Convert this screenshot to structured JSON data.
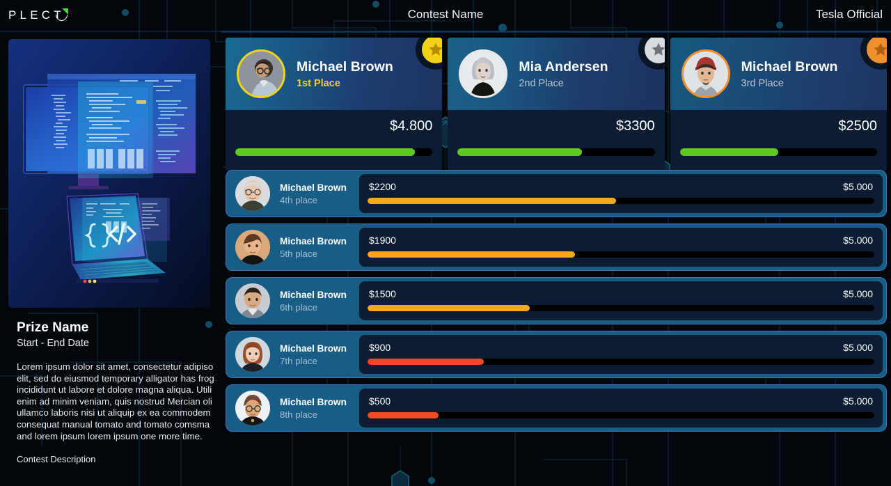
{
  "header": {
    "logo_text": "PLECT",
    "logo_icon": "plecto-circle-logo",
    "contest_title": "Contest Name",
    "account_name": "Tesla Official"
  },
  "left_panel": {
    "image_alt": "desktop-monitor-and-laptop-code-illustration",
    "prize_name": "Prize Name",
    "date_range": "Start - End Date",
    "description": "Lorem ipsum dolor sit amet, consectetur adipiso elit, sed do eiusmod temporary alligator has frog incididunt ut labore et dolore magna aliqua. Utili enim ad minim veniam, quis nostrud Mercian oli ullamco laboris nisi ut aliquip ex ea commodem consequat manual tomato and tomato comsma and lorem ipsum lorem ipsum one more time.",
    "description_label": "Contest Description"
  },
  "colors": {
    "bar_green": "#5cc91c",
    "bar_orange": "#f5a623",
    "bar_red": "#f04a23",
    "bar_track": "#000000",
    "gold": "#f4d21a",
    "silver": "#d8dce0",
    "bronze": "#ef8f2d",
    "row_bg": "#175d86",
    "row_border": "#4673b4",
    "panel_dark": "#0b1c33",
    "page_bg": "#03070b"
  },
  "podium": [
    {
      "rank": 1,
      "name": "Michael Brown",
      "place_label": "1st Place",
      "amount": "$4.800",
      "progress_pct": 91,
      "medal_icon": "gold-star-icon",
      "bar_color": "#5cc91c"
    },
    {
      "rank": 2,
      "name": "Mia Andersen",
      "place_label": "2nd Place",
      "amount": "$3300",
      "progress_pct": 63,
      "medal_icon": "silver-star-icon",
      "bar_color": "#5cc91c"
    },
    {
      "rank": 3,
      "name": "Michael Brown",
      "place_label": "3rd Place",
      "amount": "$2500",
      "progress_pct": 50,
      "medal_icon": "bronze-star-icon",
      "bar_color": "#5cc91c"
    }
  ],
  "rows": [
    {
      "name": "Michael Brown",
      "place_label": "4th place",
      "value": "$2200",
      "target": "$5.000",
      "progress_pct": 49,
      "bar_color": "#f5a623"
    },
    {
      "name": "Michael Brown",
      "place_label": "5th place",
      "value": "$1900",
      "target": "$5.000",
      "progress_pct": 41,
      "bar_color": "#f5a623"
    },
    {
      "name": "Michael Brown",
      "place_label": "6th place",
      "value": "$1500",
      "target": "$5.000",
      "progress_pct": 32,
      "bar_color": "#f5a623"
    },
    {
      "name": "Michael Brown",
      "place_label": "7th place",
      "value": "$900",
      "target": "$5.000",
      "progress_pct": 23,
      "bar_color": "#f04a23"
    },
    {
      "name": "Michael Brown",
      "place_label": "8th place",
      "value": "$500",
      "target": "$5.000",
      "progress_pct": 14,
      "bar_color": "#f04a23"
    }
  ]
}
